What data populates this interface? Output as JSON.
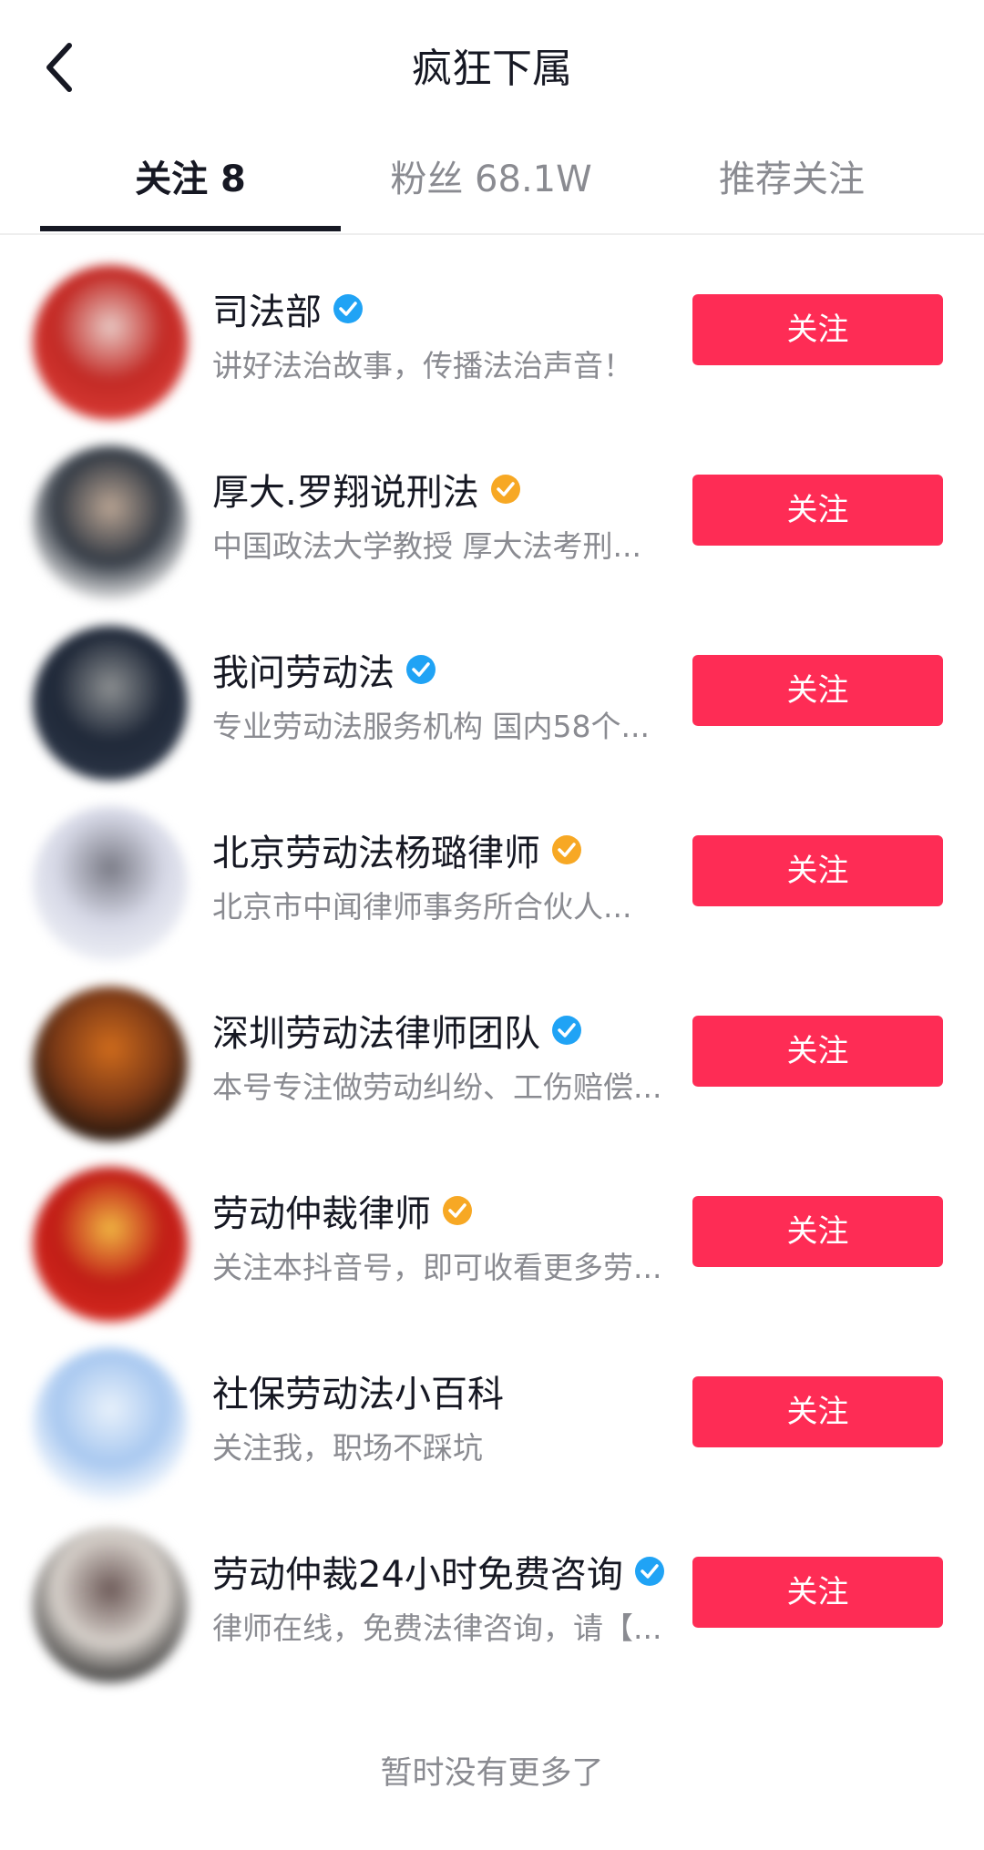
{
  "header": {
    "title": "疯狂下属"
  },
  "tabs": [
    {
      "label": "关注 8",
      "active": true
    },
    {
      "label": "粉丝 68.1W",
      "active": false
    },
    {
      "label": "推荐关注",
      "active": false
    }
  ],
  "users": [
    {
      "name": "司法部",
      "badge": "blue",
      "desc": "讲好法治故事，传播法治声音！",
      "follow_label": "关注",
      "avatar_colors": [
        "#d93a34",
        "#c22a25",
        "#e8c9c4"
      ]
    },
    {
      "name": "厚大.罗翔说刑法",
      "badge": "orange",
      "desc": "中国政法大学教授 厚大法考刑...",
      "follow_label": "关注",
      "avatar_colors": [
        "#f3f3f3",
        "#333a44",
        "#b9a493"
      ]
    },
    {
      "name": "我问劳动法",
      "badge": "blue",
      "desc": "专业劳动法服务机构 国内58个...",
      "follow_label": "关注",
      "avatar_colors": [
        "#2b3546",
        "#1f2838",
        "#8c8f91"
      ]
    },
    {
      "name": "北京劳动法杨璐律师",
      "badge": "orange",
      "desc": "北京市中闻律师事务所合伙人...",
      "follow_label": "关注",
      "avatar_colors": [
        "#eef0f6",
        "#d6d8e6",
        "#7a7b86"
      ]
    },
    {
      "name": "深圳劳动法律师团队",
      "badge": "blue",
      "desc": "本号专注做劳动纠纷、工伤赔偿...",
      "follow_label": "关注",
      "avatar_colors": [
        "#1b120d",
        "#7d3a16",
        "#cf6b1c"
      ]
    },
    {
      "name": "劳动仲裁律师",
      "badge": "orange",
      "desc": "关注本抖音号，即可收看更多劳...",
      "follow_label": "关注",
      "avatar_colors": [
        "#d5281f",
        "#c01d16",
        "#f0b642"
      ]
    },
    {
      "name": "社保劳动法小百科",
      "badge": "none",
      "desc": "关注我，职场不踩坑",
      "follow_label": "关注",
      "avatar_colors": [
        "#ffffff",
        "#a8c8f0",
        "#e8f1fb"
      ]
    },
    {
      "name": "劳动仲裁24小时免费咨询",
      "badge": "blue",
      "desc": "律师在线，免费法律咨询，请【...",
      "follow_label": "关注",
      "avatar_colors": [
        "#2b2b2b",
        "#d8d2cc",
        "#6d5a58"
      ]
    }
  ],
  "footer": {
    "text": "暂时没有更多了"
  },
  "colors": {
    "accent": "#fe2c55",
    "badge_blue": "#20a3f5",
    "badge_orange": "#f7a824"
  },
  "icons": {
    "back": "chevron-left-icon",
    "verified": "verified-badge-icon"
  }
}
